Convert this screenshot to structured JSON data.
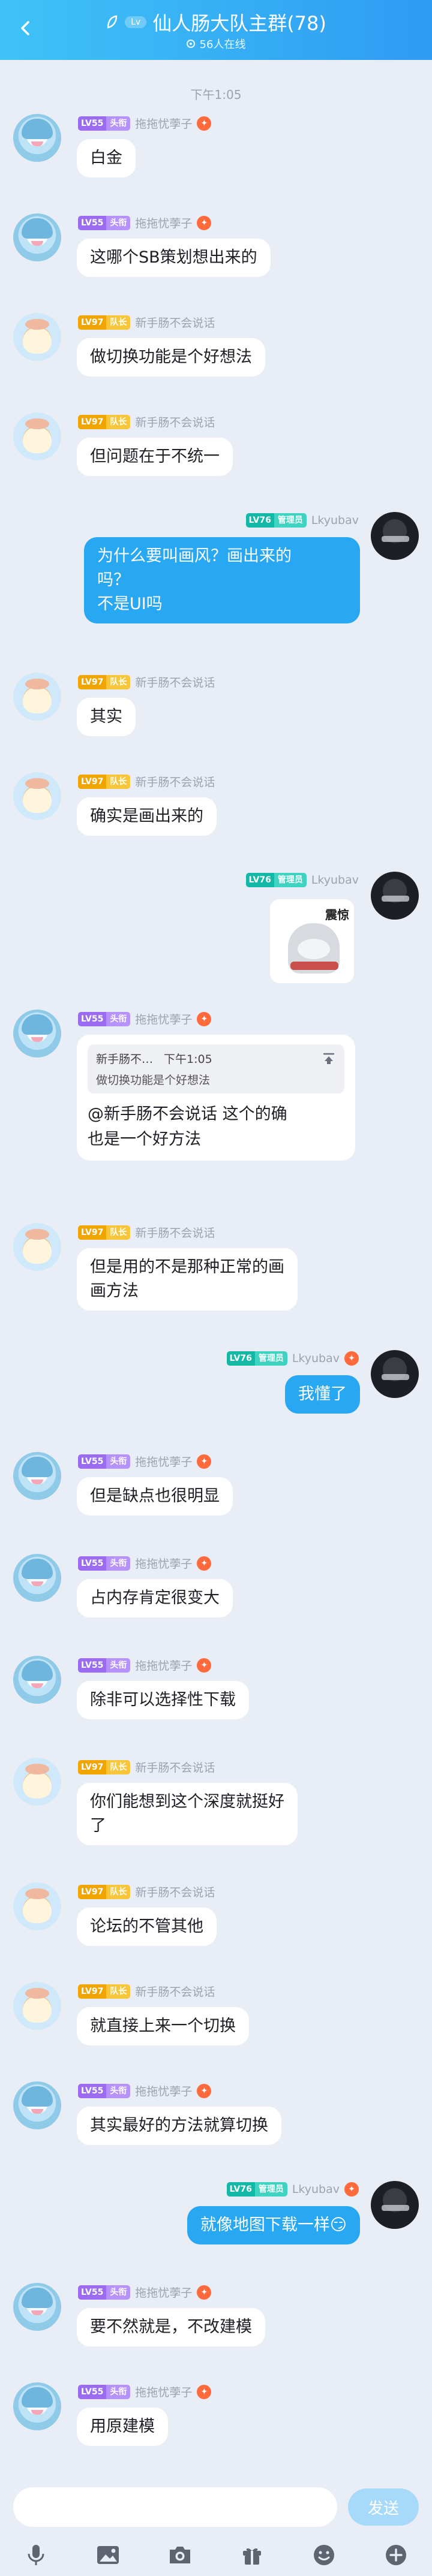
{
  "header": {
    "title": "仙人肠大队主群(78)",
    "online": "56人在线",
    "badge": "Lv"
  },
  "timestamps": {
    "first": "下午1:05"
  },
  "levels": {
    "lv55": {
      "num": "LV55",
      "title": "头衔"
    },
    "lv97": {
      "num": "LV97",
      "title": "队长"
    },
    "lv76": {
      "num": "LV76",
      "title": "管理员"
    }
  },
  "users": {
    "rem": "拖拖忧荸子",
    "bun": "新手肠不会说话",
    "lk": "Lkyubav"
  },
  "messages": [
    {
      "text": "白金"
    },
    {
      "text": "这哪个SB策划想出来的"
    },
    {
      "text": "做切换功能是个好想法"
    },
    {
      "text": "但问题在于不统一"
    },
    {
      "text": "为什么要叫画风？画出来的\n吗？\n不是UI吗"
    },
    {
      "text": "其实"
    },
    {
      "text": "确实是画出来的"
    },
    {
      "sticker_text": "震惊"
    },
    {
      "quote_name": "新手肠不…",
      "quote_time": "下午1:05",
      "quote_text": "做切换功能是个好想法",
      "text": "@新手肠不会说话 这个的确\n也是一个好方法"
    },
    {
      "text": "但是用的不是那种正常的画\n画方法"
    },
    {
      "text": "我懂了"
    },
    {
      "text": "但是缺点也很明显"
    },
    {
      "text": "占内存肯定很变大"
    },
    {
      "text": "除非可以选择性下载"
    },
    {
      "text": "你们能想到这个深度就挺好\n了"
    },
    {
      "text": "论坛的不管其他"
    },
    {
      "text": "就直接上来一个切换"
    },
    {
      "text": "其实最好的方法就算切换"
    },
    {
      "text": "就像地图下载一样😏"
    },
    {
      "text": "要不然就是，不改建模"
    },
    {
      "text": "用原建模"
    }
  ],
  "input": {
    "placeholder": "",
    "send": "发送"
  },
  "icons": [
    "mic-icon",
    "image-icon",
    "camera-icon",
    "gift-icon",
    "emoji-icon",
    "plus-icon"
  ]
}
